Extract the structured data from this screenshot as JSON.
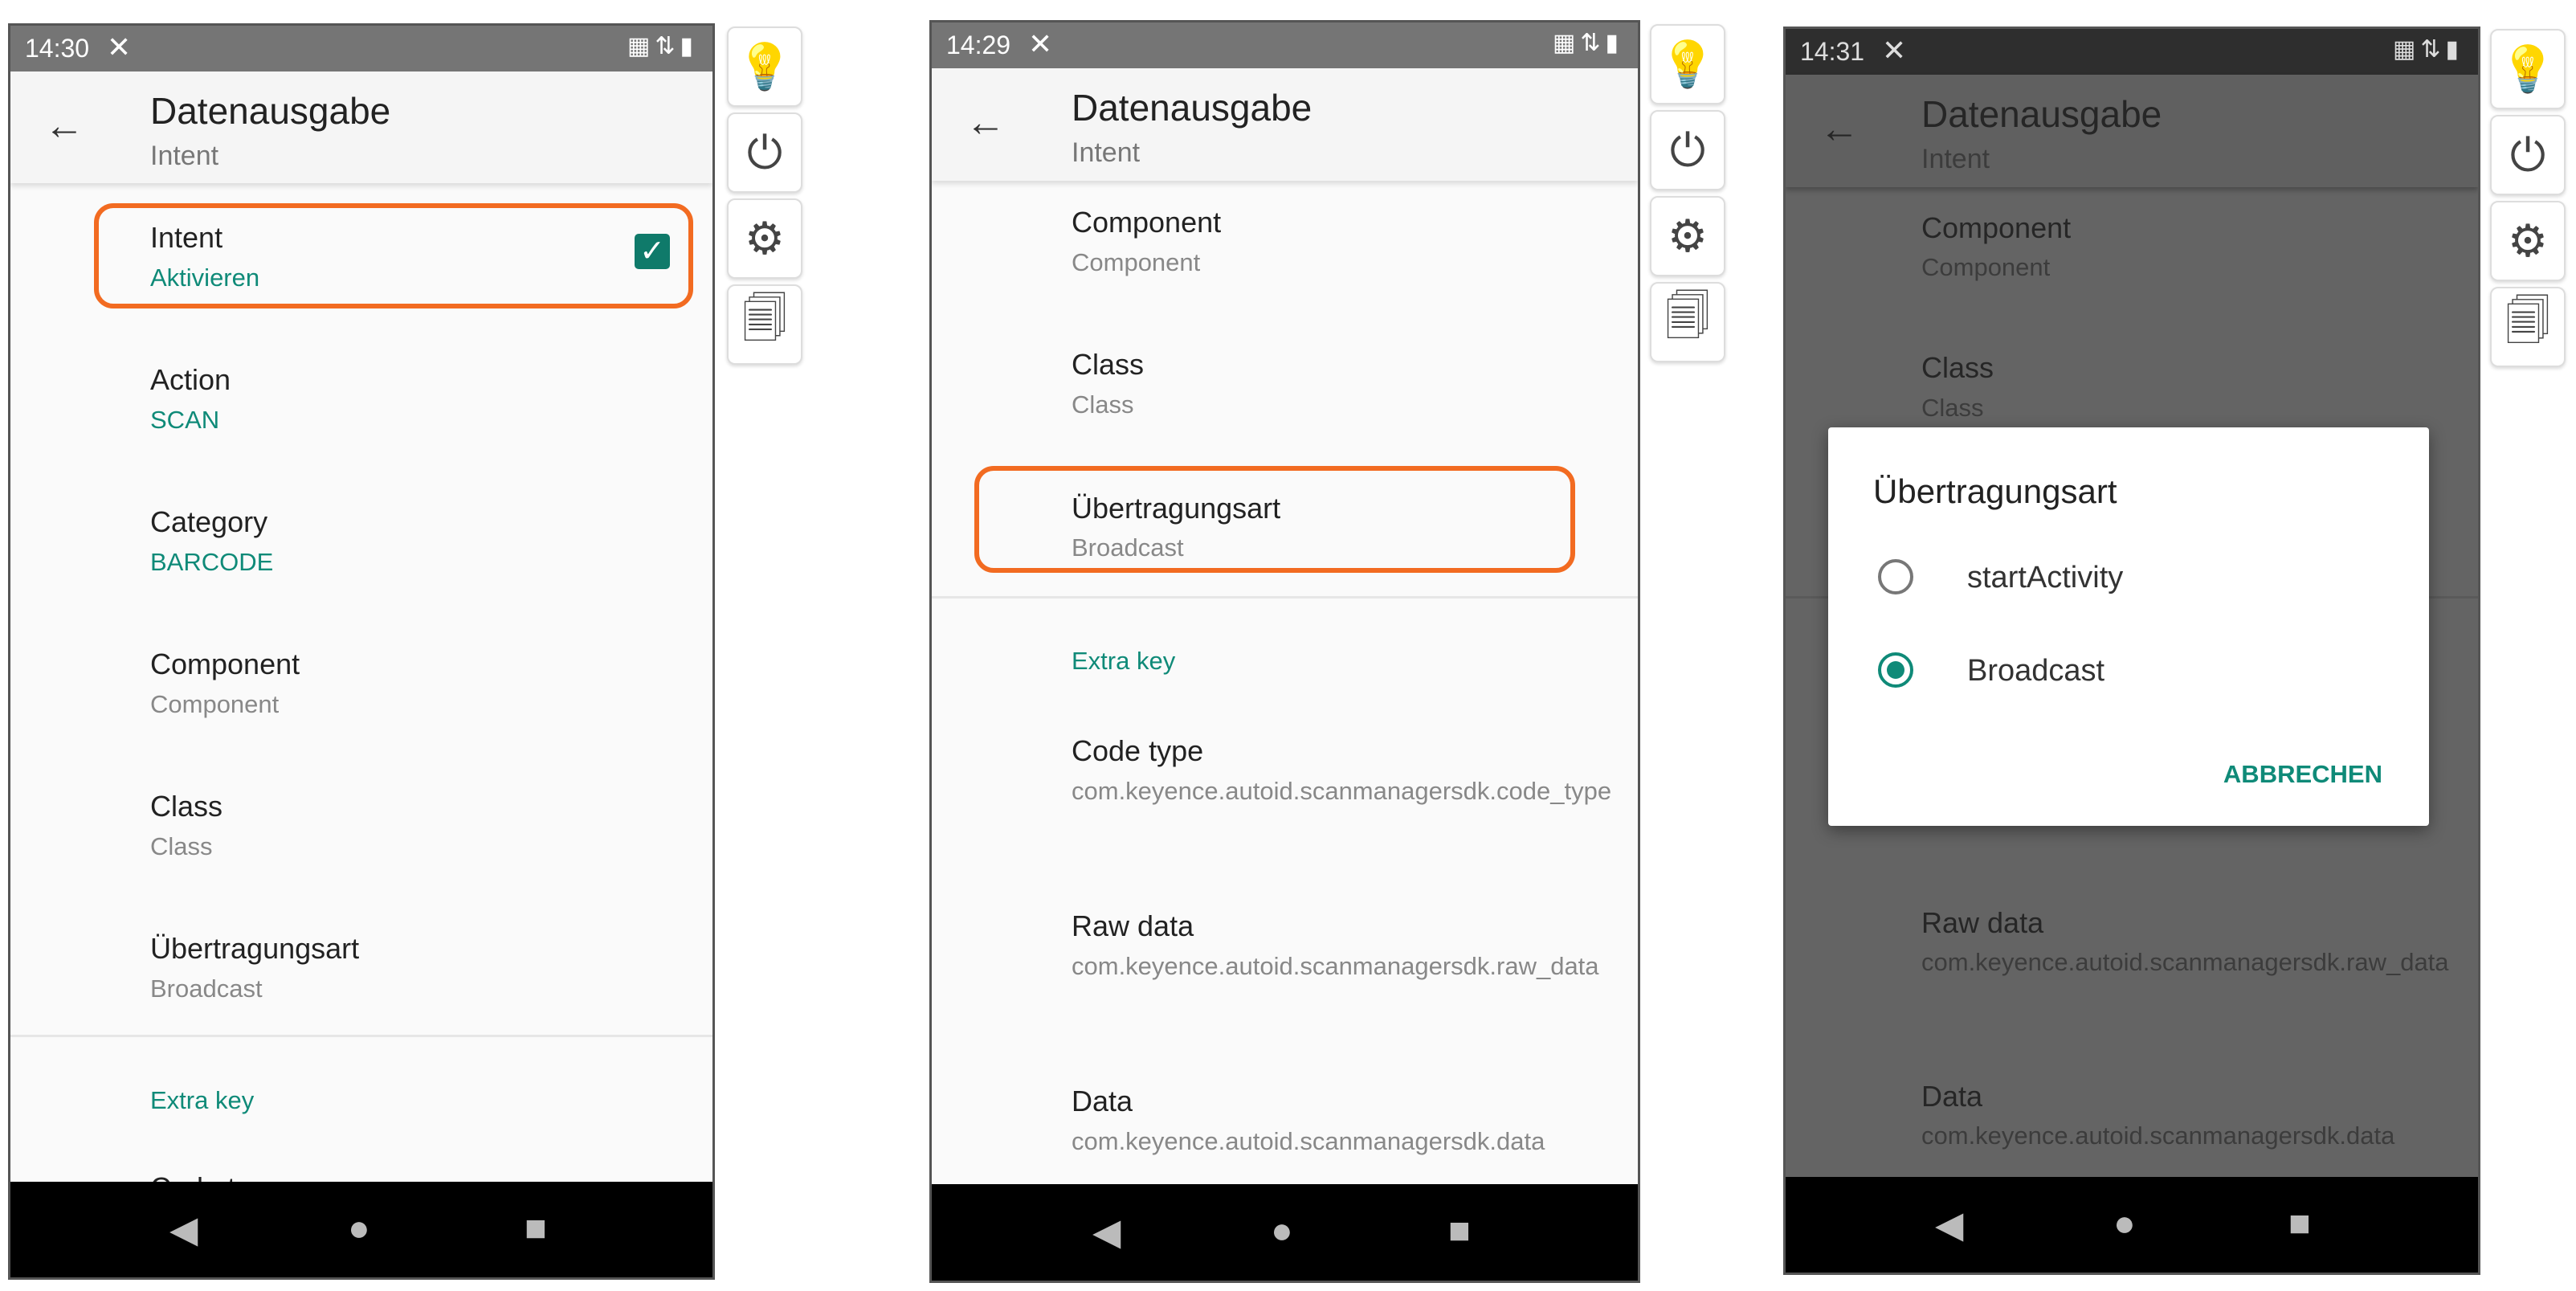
{
  "colors": {
    "accent": "#0f8a78",
    "highlight": "#f26b21"
  },
  "side_buttons": [
    {
      "icon": "lightbulb-icon",
      "glyph": "💡"
    },
    {
      "icon": "power-icon",
      "glyph": "⏻"
    },
    {
      "icon": "gear-icon",
      "glyph": "⚙"
    },
    {
      "icon": "list-icon",
      "glyph": "🗐"
    }
  ],
  "nav": {
    "back": "◀",
    "home": "●",
    "recents": "■"
  },
  "screen1": {
    "time": "14:30",
    "title": "Datenausgabe",
    "subtitle": "Intent",
    "items": [
      {
        "title": "Intent",
        "value": "Aktivieren",
        "checked": true
      },
      {
        "title": "Action",
        "value": "SCAN"
      },
      {
        "title": "Category",
        "value": "BARCODE"
      },
      {
        "title": "Component",
        "value": "Component"
      },
      {
        "title": "Class",
        "value": "Class"
      },
      {
        "title": "Übertragungsart",
        "value": "Broadcast"
      }
    ],
    "category": "Extra key",
    "partial_item": "Code type"
  },
  "screen2": {
    "time": "14:29",
    "title": "Datenausgabe",
    "subtitle": "Intent",
    "items": [
      {
        "title": "Component",
        "value": "Component"
      },
      {
        "title": "Class",
        "value": "Class"
      },
      {
        "title": "Übertragungsart",
        "value": "Broadcast"
      }
    ],
    "category": "Extra key",
    "extras": [
      {
        "title": "Code type",
        "value": "com.keyence.autoid.scanmanagersdk.code_type"
      },
      {
        "title": "Raw data",
        "value": "com.keyence.autoid.scanmanagersdk.raw_data"
      },
      {
        "title": "Data",
        "value": "com.keyence.autoid.scanmanagersdk.data"
      }
    ]
  },
  "screen3": {
    "time": "14:31",
    "title": "Datenausgabe",
    "subtitle": "Intent",
    "items": [
      {
        "title": "Component",
        "value": "Component"
      },
      {
        "title": "Class",
        "value": "Class"
      },
      {
        "title": "Raw data",
        "value": "com.keyence.autoid.scanmanagersdk.raw_data"
      },
      {
        "title": "Data",
        "value": "com.keyence.autoid.scanmanagersdk.data"
      }
    ],
    "dialog": {
      "title": "Übertragungsart",
      "options": [
        {
          "label": "startActivity",
          "selected": false
        },
        {
          "label": "Broadcast",
          "selected": true
        }
      ],
      "cancel": "ABBRECHEN"
    }
  }
}
